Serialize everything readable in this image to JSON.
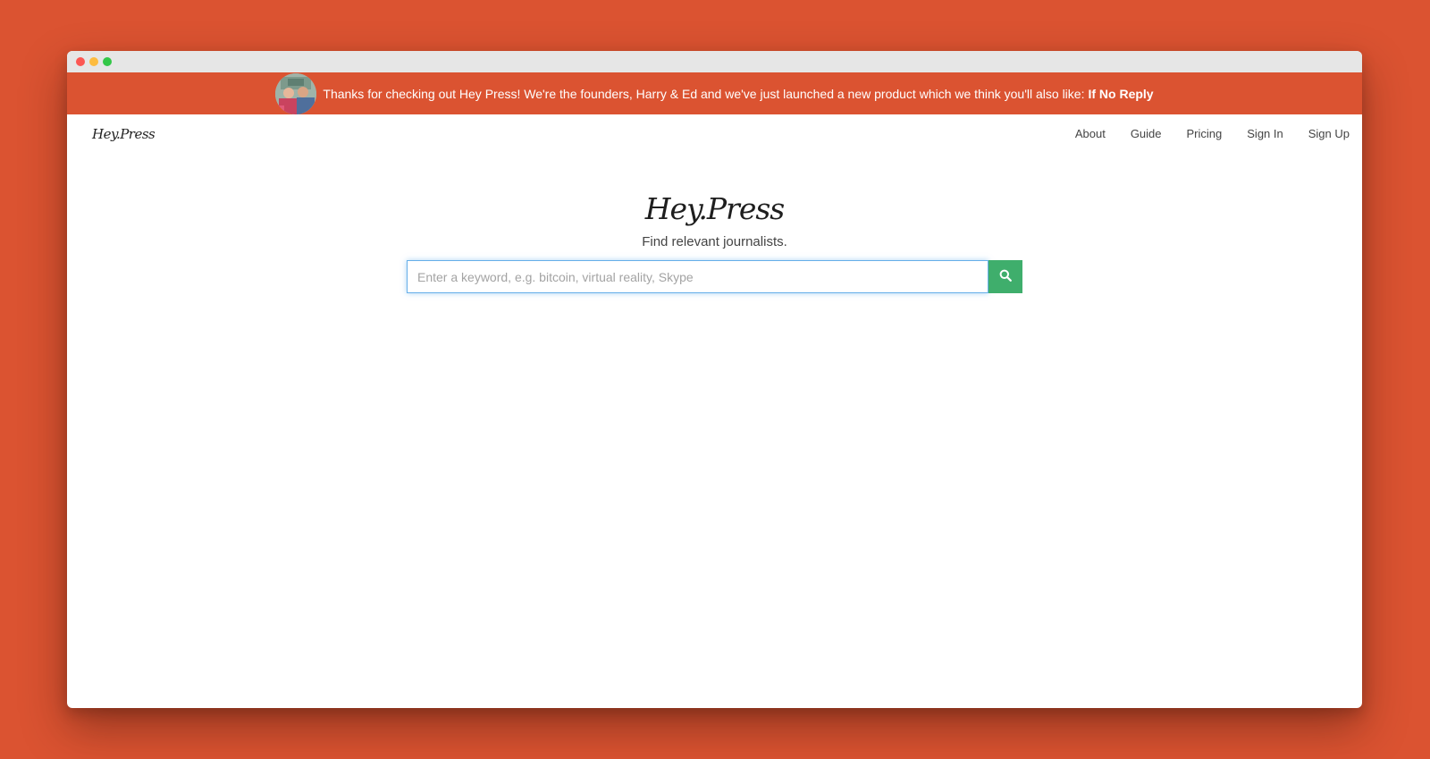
{
  "banner": {
    "message": "Thanks for checking out Hey Press! We're the founders, Harry & Ed and we've just launched a new product which we think you'll also like:",
    "link_label": "If No Reply"
  },
  "navbar": {
    "brand": "Hey.Press",
    "links": [
      "About",
      "Guide",
      "Pricing",
      "Sign In",
      "Sign Up"
    ]
  },
  "hero": {
    "title": "Hey.Press",
    "tagline": "Find relevant journalists."
  },
  "search": {
    "placeholder": "Enter a keyword, e.g. bitcoin, virtual reality, Skype",
    "value": "",
    "button_icon": "search-icon"
  },
  "colors": {
    "background": "#db5331",
    "banner": "#db5331",
    "search_button": "#3fae6c",
    "input_focus": "#66afe9"
  }
}
